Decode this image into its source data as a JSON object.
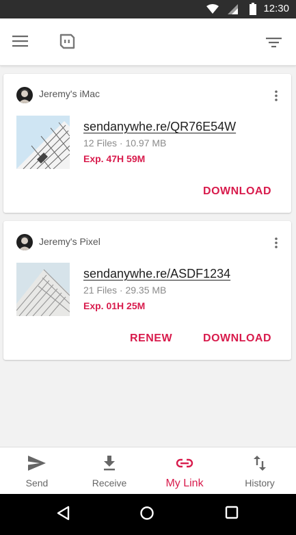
{
  "status_bar": {
    "time": "12:30"
  },
  "cards": [
    {
      "device": "Jeremy's iMac",
      "link": "sendanywhe.re/QR76E54W",
      "meta": "12 Files · 10.97 MB",
      "expiry": "Exp. 47H 59M",
      "actions": [
        "DOWNLOAD"
      ]
    },
    {
      "device": "Jeremy's Pixel",
      "link": "sendanywhe.re/ASDF1234",
      "meta": "21 Files · 29.35 MB",
      "expiry": "Exp. 01H 25M",
      "actions": [
        "RENEW",
        "DOWNLOAD"
      ]
    }
  ],
  "bottom_nav": [
    {
      "label": "Send",
      "icon": "send-icon"
    },
    {
      "label": "Receive",
      "icon": "download-icon"
    },
    {
      "label": "My Link",
      "icon": "link-icon",
      "active": true
    },
    {
      "label": "History",
      "icon": "history-icon"
    }
  ],
  "colors": {
    "accent": "#d81b4c",
    "status_bar": "#2e2e2e"
  }
}
